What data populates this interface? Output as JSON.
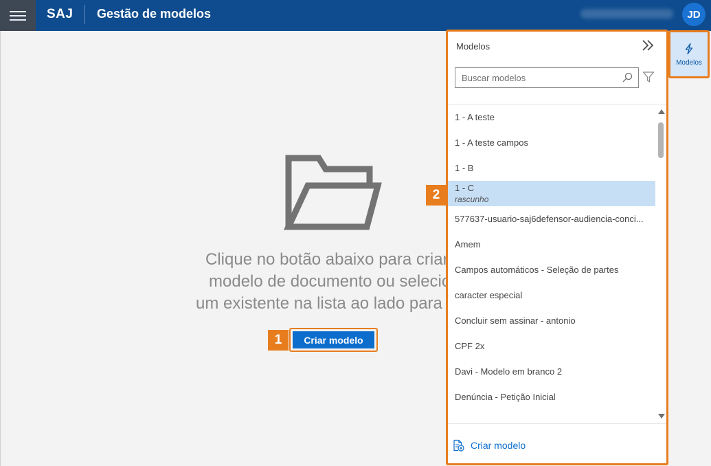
{
  "topbar": {
    "brand": "SAJ",
    "title": "Gestão de modelos",
    "avatar_initials": "JD",
    "color": "#0e4c8f"
  },
  "main": {
    "empty_lines": [
      "Clique no botão abaixo para criar um",
      "modelo de documento ou selecionar",
      "um existente na lista ao lado para editar"
    ],
    "create_button_label": "Criar modelo"
  },
  "callouts": {
    "badge1": "1",
    "badge2": "2",
    "color": "#e87d1e"
  },
  "panel": {
    "header": "Modelos",
    "search_placeholder": "Buscar modelos",
    "items": [
      {
        "label": "1 - A teste",
        "sub": ""
      },
      {
        "label": "1 - A teste campos",
        "sub": ""
      },
      {
        "label": "1 - B",
        "sub": ""
      },
      {
        "label": "1 - C",
        "sub": "rascunho",
        "selected": true
      },
      {
        "label": "577637-usuario-saj6defensor-audiencia-conci...",
        "sub": ""
      },
      {
        "label": "Amem",
        "sub": ""
      },
      {
        "label": "Campos automáticos - Seleção de partes",
        "sub": ""
      },
      {
        "label": "caracter especial",
        "sub": ""
      },
      {
        "label": "Concluir sem assinar - antonio",
        "sub": ""
      },
      {
        "label": "CPF 2x",
        "sub": ""
      },
      {
        "label": "Davi - Modelo em branco 2",
        "sub": ""
      },
      {
        "label": "Denúncia - Petição Inicial",
        "sub": ""
      }
    ],
    "create_label": "Criar modelo"
  },
  "rail": {
    "label": "Modelos",
    "icon": "lightning-icon"
  }
}
